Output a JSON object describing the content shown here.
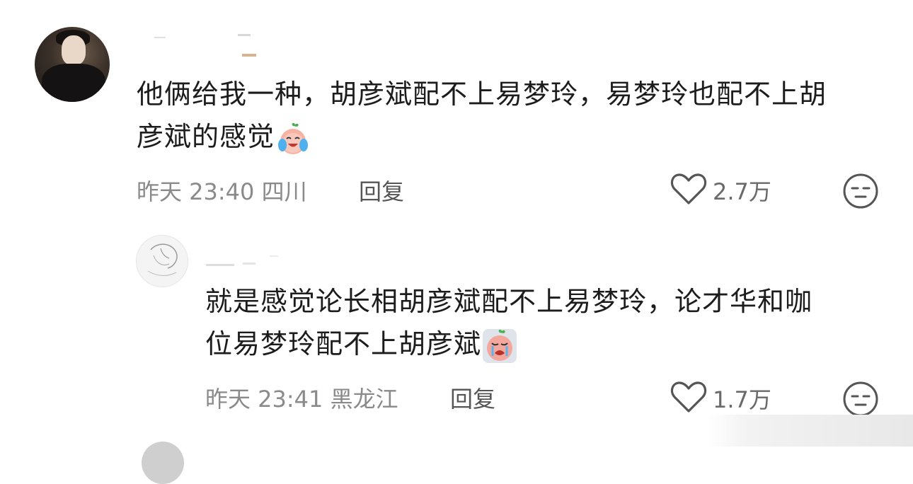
{
  "comments": [
    {
      "text": "他俩给我一种，胡彦斌配不上易梦玲，易梦玲也配不上胡彦斌的感觉",
      "text_line1": "他俩给我一种，胡彦斌配不上易梦玲，易梦玲也配不上胡",
      "text_line2": "彦斌的感觉",
      "emoji_icon": "crying-laughing-peach-emoji",
      "time": "昨天 23:40",
      "location": "四川",
      "reply_label": "回复",
      "like_count": "2.7万"
    },
    {
      "text": "就是感觉论长相胡彦斌配不上易梦玲，论才华和咖位易梦玲配不上胡彦斌",
      "text_line1": "就是感觉论长相胡彦斌配不上易梦玲，论才华和咖",
      "text_line2": "位易梦玲配不上胡彦斌",
      "emoji_icon": "crying-peach-emoji",
      "time": "昨天 23:41",
      "location": "黑龙江",
      "reply_label": "回复",
      "like_count": "1.7万"
    }
  ],
  "colors": {
    "text": "#1c1c1c",
    "meta": "#8a8a8a",
    "icon": "#555555"
  }
}
